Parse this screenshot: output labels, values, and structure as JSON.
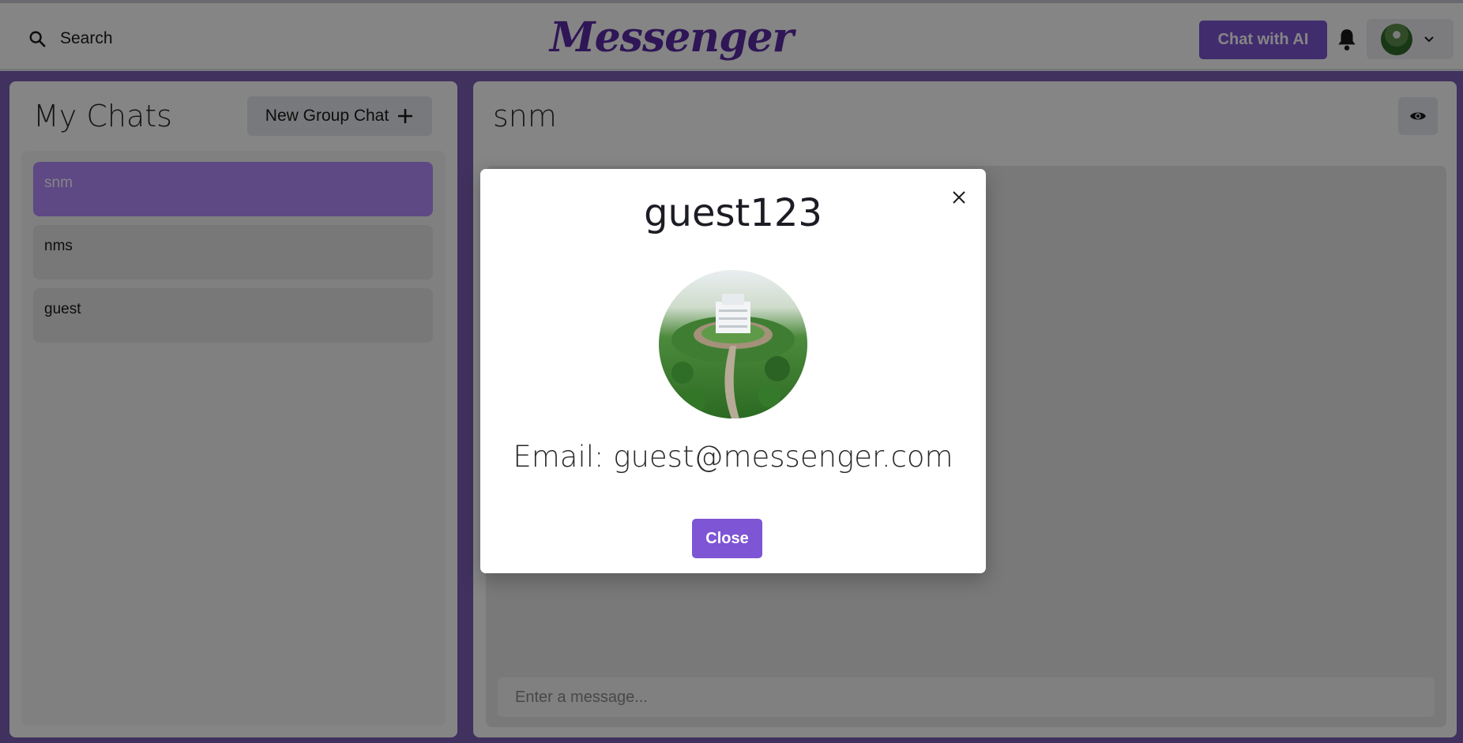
{
  "header": {
    "search_label": "Search",
    "logo_text": "Messenger",
    "ai_button_label": "Chat with AI"
  },
  "sidebar": {
    "title": "My Chats",
    "new_group_label": "New Group Chat",
    "chats": [
      {
        "name": "snm",
        "active": true
      },
      {
        "name": "nms",
        "active": false
      },
      {
        "name": "guest",
        "active": false
      }
    ]
  },
  "chat": {
    "title": "snm",
    "input_placeholder": "Enter a message..."
  },
  "modal": {
    "username": "guest123",
    "email_text": "Email: guest@messenger.com",
    "close_label": "Close"
  },
  "colors": {
    "accent": "#7e55d4",
    "active_chat": "#b58cff",
    "page_background": "#7b5fb4"
  }
}
